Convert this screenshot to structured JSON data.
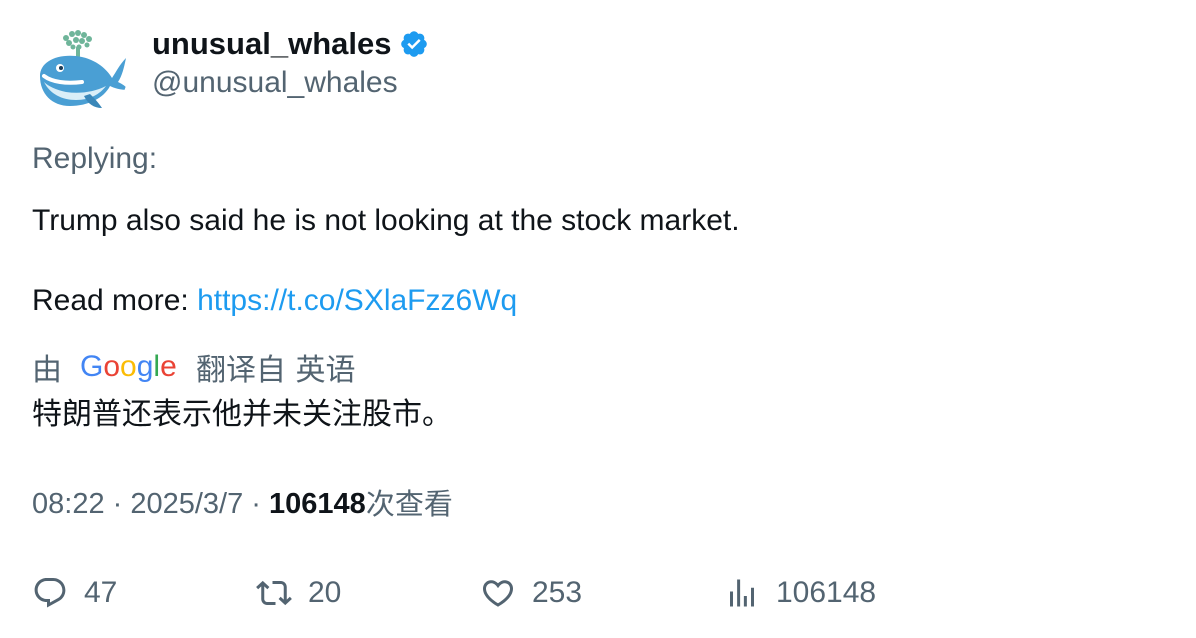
{
  "account": {
    "display_name": "unusual_whales",
    "handle": "@unusual_whales",
    "verified": true,
    "verified_color": "#1d9bf0"
  },
  "tweet": {
    "replying_label": "Replying:",
    "text": "Trump also said he is not looking at the stock market.",
    "read_more_label": "Read more: ",
    "link_text": "https://t.co/SXlaFzz6Wq",
    "link_color": "#1d9bf0"
  },
  "translation": {
    "by_label": "由",
    "provider": "Google",
    "translated_from_label": "翻译自 英语",
    "text": "特朗普还表示他并未关注股市。"
  },
  "meta": {
    "time": "08:22",
    "separator": " · ",
    "date": "2025/3/7",
    "views_count": "106148",
    "views_label": "次查看"
  },
  "actions": {
    "replies": "47",
    "retweets": "20",
    "likes": "253",
    "views": "106148"
  },
  "icons": {
    "reply": "reply-icon",
    "retweet": "retweet-icon",
    "like": "heart-icon",
    "views": "views-chart-icon",
    "verified": "verified-badge-icon"
  }
}
